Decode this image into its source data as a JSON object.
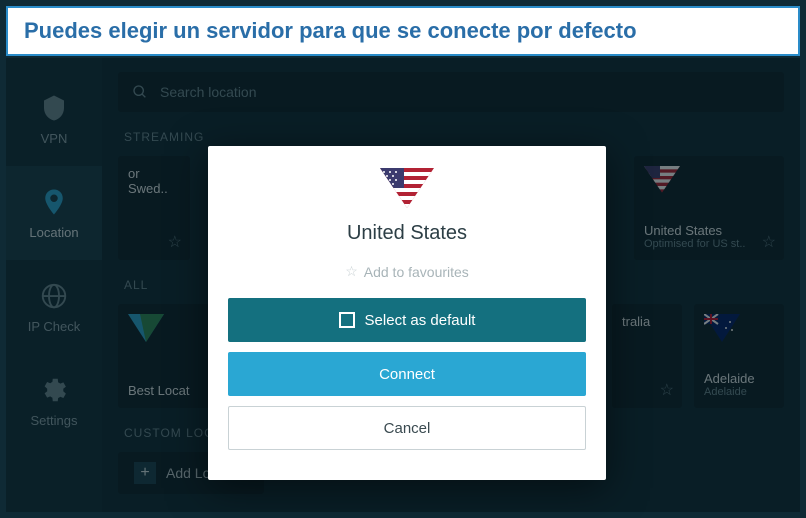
{
  "caption": "Puedes elegir un servidor para que se conecte por defecto",
  "sidebar": {
    "items": [
      {
        "label": "VPN",
        "icon": "shield-icon"
      },
      {
        "label": "Location",
        "icon": "pin-icon"
      },
      {
        "label": "IP Check",
        "icon": "globe-icon"
      },
      {
        "label": "Settings",
        "icon": "gear-icon"
      }
    ]
  },
  "search": {
    "placeholder": "Search location"
  },
  "sections": {
    "streaming": {
      "label": "STREAMING",
      "cards": [
        {
          "title": "or Swed..",
          "sub": ""
        },
        {
          "title": "United States",
          "sub": "Optimised for US st.."
        }
      ]
    },
    "all": {
      "label": "ALL",
      "cards": [
        {
          "title": "Best Locat",
          "sub": ""
        },
        {
          "title": "tralia",
          "sub": ""
        },
        {
          "title": "Adelaide",
          "sub": "Adelaide"
        }
      ]
    },
    "custom": {
      "label": "CUSTOM LOC",
      "add": "Add Location"
    }
  },
  "modal": {
    "country": "United States",
    "favourite": "Add to favourites",
    "select_default": "Select as default",
    "connect": "Connect",
    "cancel": "Cancel"
  }
}
